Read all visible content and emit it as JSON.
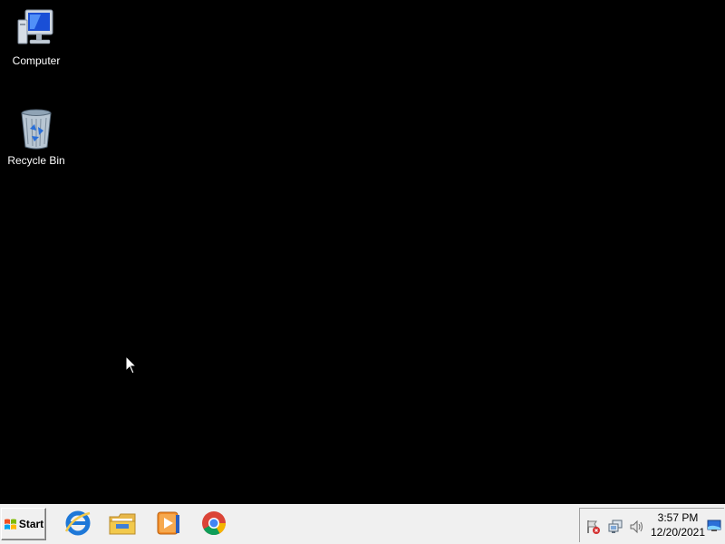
{
  "desktop": {
    "background": "#000000",
    "icons": [
      {
        "label": "Computer",
        "icon": "computer-icon"
      },
      {
        "label": "Recycle Bin",
        "icon": "recycle-bin-icon"
      }
    ]
  },
  "taskbar": {
    "start_label": "Start",
    "pinned": [
      {
        "name": "Internet Explorer",
        "icon": "internet-explorer-icon"
      },
      {
        "name": "Windows Explorer",
        "icon": "file-explorer-icon"
      },
      {
        "name": "Windows Media Player",
        "icon": "media-player-icon"
      },
      {
        "name": "Google Chrome",
        "icon": "chrome-icon"
      }
    ],
    "tray": {
      "icons": [
        "action-center-icon",
        "network-icon",
        "volume-icon"
      ],
      "time": "3:57 PM",
      "date": "12/20/2021"
    },
    "colors": {
      "taskbar_bg": "#f0f0f0",
      "ie_blue": "#1e78d8",
      "folder_yellow": "#f2c94c",
      "media_orange": "#f28c28"
    }
  }
}
